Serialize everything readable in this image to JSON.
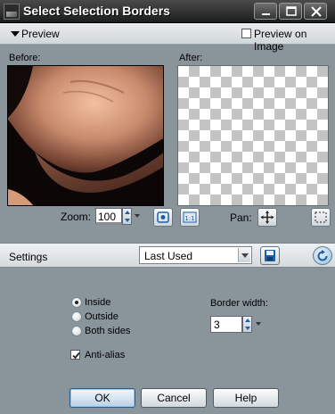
{
  "window": {
    "title": "Select Selection Borders",
    "controls": [
      "minimize",
      "maximize",
      "close"
    ]
  },
  "preview": {
    "label": "Preview",
    "preview_on_image_label": "Preview on Image",
    "preview_on_image_checked": false,
    "before_label": "Before:",
    "after_label": "After:"
  },
  "zoom": {
    "label": "Zoom:",
    "value": "100",
    "pan_label": "Pan:"
  },
  "settings": {
    "label": "Settings",
    "selected": "Last Used"
  },
  "options": {
    "radios": [
      {
        "label": "Inside",
        "selected": true
      },
      {
        "label": "Outside",
        "selected": false
      },
      {
        "label": "Both sides",
        "selected": false
      }
    ],
    "anti_alias_label": "Anti-alias",
    "anti_alias_checked": true,
    "border_width_label": "Border width:",
    "border_width_value": "3"
  },
  "buttons": {
    "ok": "OK",
    "cancel": "Cancel",
    "help": "Help"
  },
  "icons": [
    "app-icon",
    "minimize-icon",
    "maximize-icon",
    "close-icon",
    "expand-triangle-icon",
    "zoom-fit-icon",
    "actual-size-icon",
    "pan-icon",
    "selection-marquee-icon",
    "save-preset-icon",
    "reset-icon",
    "checkmark-icon"
  ],
  "colors": {
    "dialog_bg": "#8a949b",
    "titlebar": "#1d1d1d",
    "accent_blue": "#1c5fa8"
  }
}
